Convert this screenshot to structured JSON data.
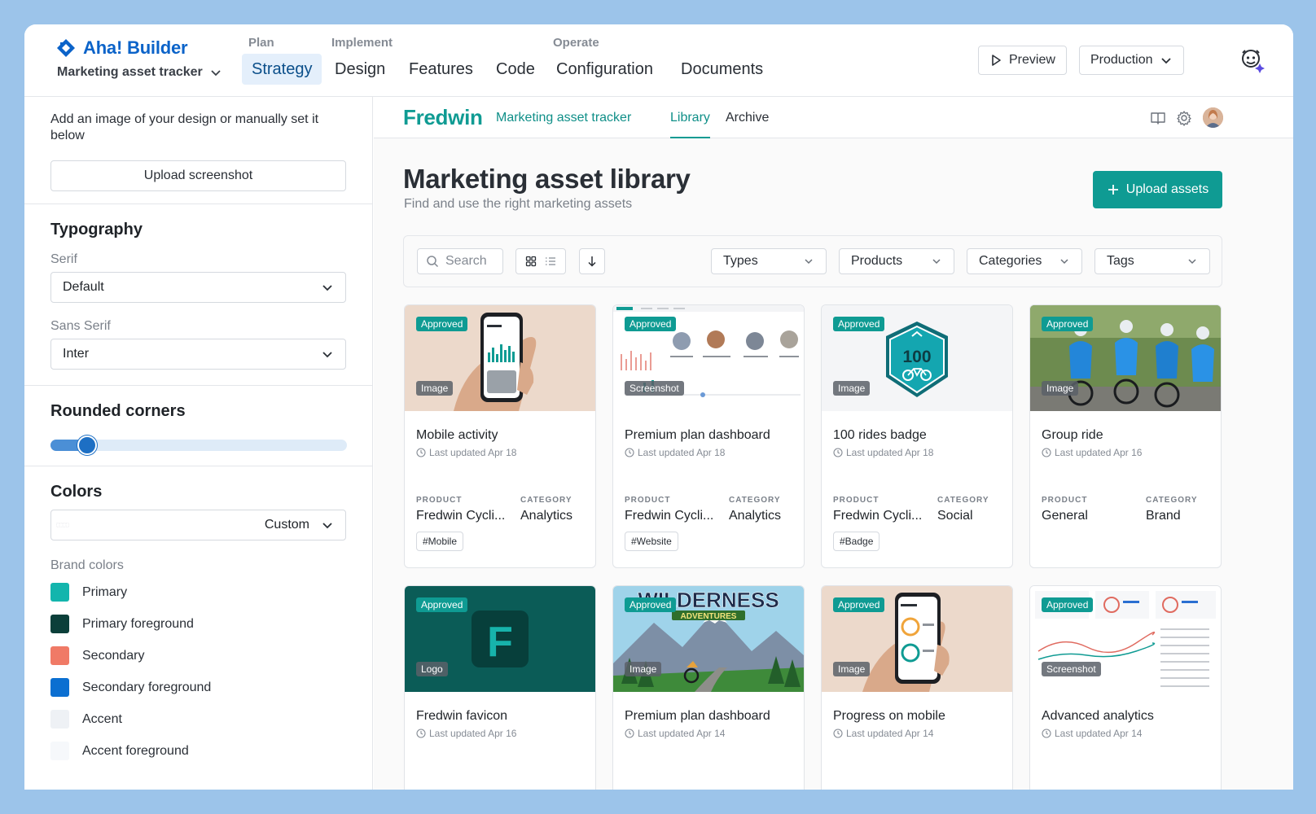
{
  "header": {
    "brand": "Aha! Builder",
    "workspace": "Marketing asset tracker",
    "groups": {
      "plan": "Plan",
      "implement": "Implement",
      "operate": "Operate"
    },
    "nav": [
      "Strategy",
      "Design",
      "Features",
      "Code",
      "Configuration",
      "Documents"
    ],
    "active_nav": "Strategy",
    "preview_label": "Preview",
    "environment": "Production"
  },
  "left_panel": {
    "description": "Add an image of your design or manually set it below",
    "upload_label": "Upload screenshot",
    "typography": {
      "title": "Typography",
      "serif_label": "Serif",
      "serif_value": "Default",
      "sans_label": "Sans Serif",
      "sans_value": "Inter"
    },
    "corners": {
      "title": "Rounded corners",
      "value": 0.09
    },
    "colors": {
      "title": "Colors",
      "palette_value": "Custom",
      "brand_label": "Brand colors",
      "items": [
        {
          "label": "Primary",
          "color": "#13b5ad"
        },
        {
          "label": "Primary foreground",
          "color": "#0b3f3a"
        },
        {
          "label": "Secondary",
          "color": "#f07a66"
        },
        {
          "label": "Secondary foreground",
          "color": "#0b6fd1"
        },
        {
          "label": "Accent",
          "color": "#eef1f5"
        },
        {
          "label": "Accent foreground",
          "color": "#f6f8fb"
        }
      ]
    }
  },
  "app": {
    "logo": "Fredwin",
    "name": "Marketing asset tracker",
    "tabs": [
      "Library",
      "Archive"
    ],
    "active_tab": "Library",
    "page_title": "Marketing asset library",
    "page_subtitle": "Find and use the right marketing assets",
    "upload_assets_label": "Upload assets",
    "search_placeholder": "Search",
    "filters": [
      "Types",
      "Products",
      "Categories",
      "Tags"
    ],
    "meta_labels": {
      "product": "PRODUCT",
      "category": "CATEGORY"
    },
    "accent": "#0f9b93"
  },
  "cards": [
    {
      "status": "Approved",
      "type": "Image",
      "title": "Mobile activity",
      "updated": "Last updated Apr 18",
      "product": "Fredwin Cycli...",
      "category": "Analytics",
      "tag": "#Mobile"
    },
    {
      "status": "Approved",
      "type": "Screenshot",
      "title": "Premium plan dashboard",
      "updated": "Last updated Apr 18",
      "product": "Fredwin Cycli...",
      "category": "Analytics",
      "tag": "#Website"
    },
    {
      "status": "Approved",
      "type": "Image",
      "title": "100 rides badge",
      "updated": "Last updated Apr 18",
      "product": "Fredwin Cycli...",
      "category": "Social",
      "tag": "#Badge",
      "badge_number": "100"
    },
    {
      "status": "Approved",
      "type": "Image",
      "title": "Group ride",
      "updated": "Last updated Apr 16",
      "product": "General",
      "category": "Brand",
      "tag": ""
    },
    {
      "status": "Approved",
      "type": "Logo",
      "title": "Fredwin favicon",
      "updated": "Last updated Apr 16",
      "logo_letter": "F"
    },
    {
      "status": "Approved",
      "type": "Image",
      "title": "Premium plan dashboard",
      "updated": "Last updated Apr 14",
      "poster_title": "WILDERNESS",
      "poster_subtitle": "ADVENTURES"
    },
    {
      "status": "Approved",
      "type": "Image",
      "title": "Progress on mobile",
      "updated": "Last updated Apr 14"
    },
    {
      "status": "Approved",
      "type": "Screenshot",
      "title": "Advanced analytics",
      "updated": "Last updated Apr 14"
    }
  ]
}
